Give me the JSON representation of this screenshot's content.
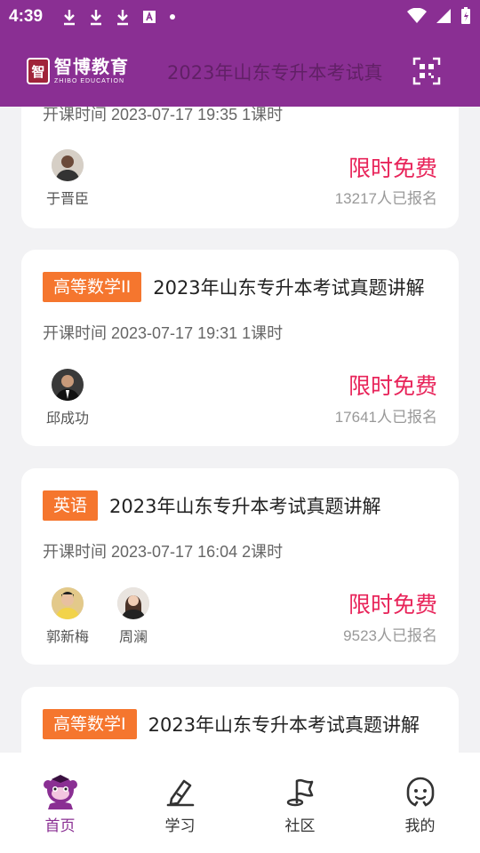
{
  "status_bar": {
    "time": "4:39",
    "icons_left": [
      "download-icon",
      "download-icon",
      "download-icon",
      "font-app-icon",
      "dot-icon"
    ],
    "icons_right": [
      "wifi-icon",
      "signal-icon",
      "battery-charging-icon"
    ]
  },
  "header": {
    "logo_name": "智博教育",
    "logo_sub": "ZHIBO EDUCATION",
    "logo_badge": "智",
    "title": "2023年山东专升本考试真",
    "scan_icon": "qr-scan-icon"
  },
  "courses": [
    {
      "tag": "",
      "title": "",
      "time": "开课时间 2023-07-17 19:35 1课时",
      "teachers": [
        "于晋臣"
      ],
      "price": "限时免费",
      "signup": "13217人已报名"
    },
    {
      "tag": "高等数学II",
      "title": "2023年山东专升本考试真题讲解",
      "time": "开课时间 2023-07-17 19:31 1课时",
      "teachers": [
        "邱成功"
      ],
      "price": "限时免费",
      "signup": "17641人已报名"
    },
    {
      "tag": "英语",
      "title": "2023年山东专升本考试真题讲解",
      "time": "开课时间 2023-07-17 16:04 2课时",
      "teachers": [
        "郭新梅",
        "周澜"
      ],
      "price": "限时免费",
      "signup": "9523人已报名"
    },
    {
      "tag": "高等数学I",
      "title": "2023年山东专升本考试真题讲解",
      "time": "",
      "teachers": [],
      "price": "",
      "signup": ""
    }
  ],
  "bottom_nav": [
    {
      "label": "首页",
      "icon": "home-mascot-icon",
      "active": true
    },
    {
      "label": "学习",
      "icon": "pen-icon",
      "active": false
    },
    {
      "label": "社区",
      "icon": "flag-icon",
      "active": false
    },
    {
      "label": "我的",
      "icon": "smiley-icon",
      "active": false
    }
  ],
  "colors": {
    "brand": "#8a2f93",
    "tag": "#f5762e",
    "price": "#e8245a"
  }
}
